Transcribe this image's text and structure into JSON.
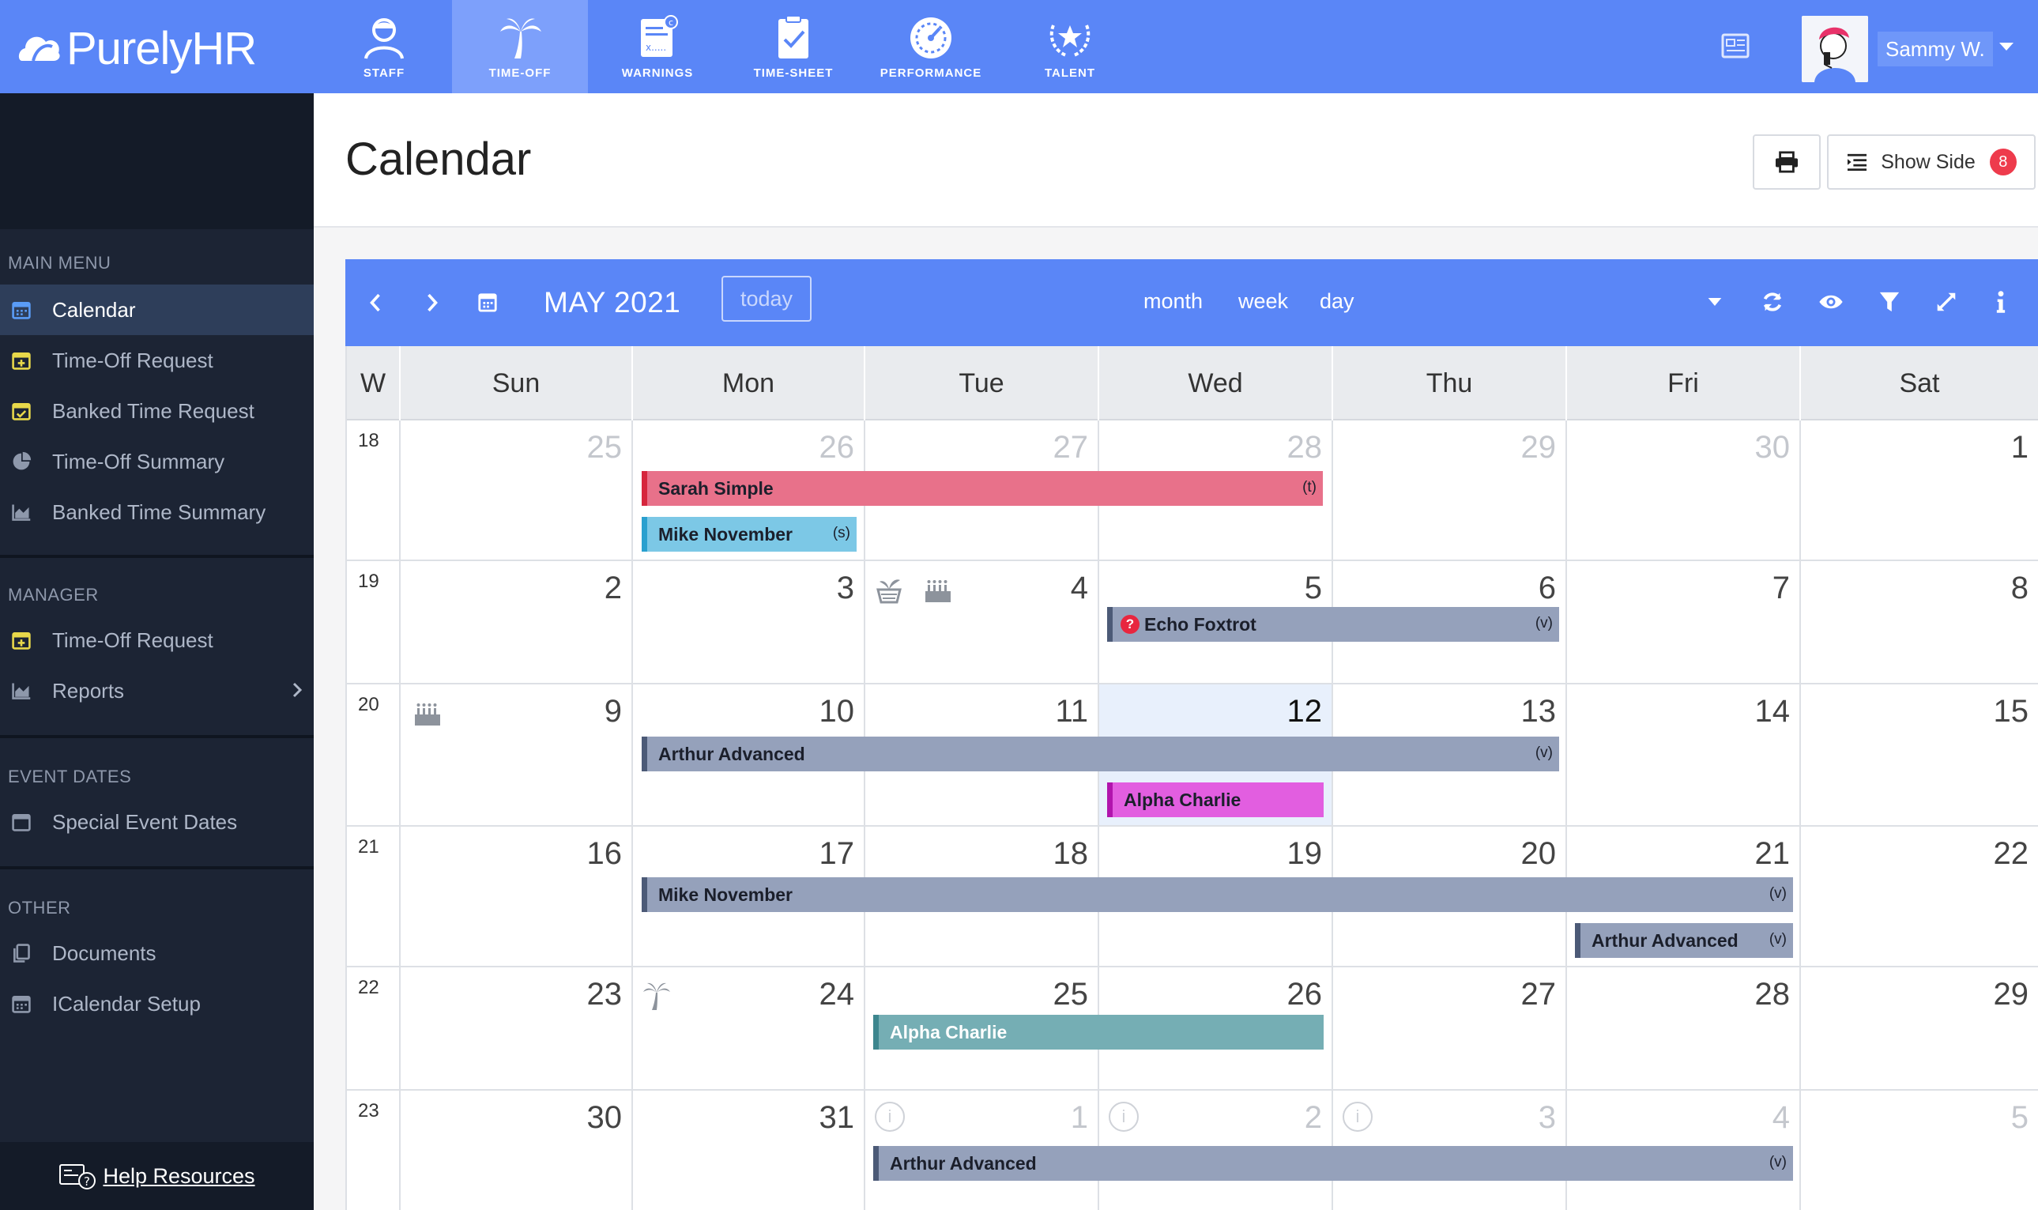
{
  "app": {
    "brand": "PurelyHR",
    "nav": [
      {
        "label": "STAFF",
        "icon": "staff-icon",
        "active": false
      },
      {
        "label": "TIME-OFF",
        "icon": "palm-tree-icon",
        "active": true
      },
      {
        "label": "WARNINGS",
        "icon": "warning-document-icon",
        "active": false
      },
      {
        "label": "TIME-SHEET",
        "icon": "clipboard-check-icon",
        "active": false
      },
      {
        "label": "PERFORMANCE",
        "icon": "gauge-icon",
        "active": false
      },
      {
        "label": "TALENT",
        "icon": "laurel-star-icon",
        "active": false
      }
    ],
    "user": {
      "name": "Sammy W."
    }
  },
  "sidebar": {
    "sections": [
      {
        "title": "MAIN MENU",
        "items": [
          {
            "label": "Calendar",
            "icon": "calendar-icon",
            "active": true
          },
          {
            "label": "Time-Off Request",
            "icon": "calendar-plus-icon"
          },
          {
            "label": "Banked Time Request",
            "icon": "calendar-check-icon"
          },
          {
            "label": "Time-Off Summary",
            "icon": "pie-chart-icon"
          },
          {
            "label": "Banked Time Summary",
            "icon": "area-chart-icon"
          }
        ]
      },
      {
        "title": "MANAGER",
        "items": [
          {
            "label": "Time-Off Request",
            "icon": "calendar-plus-icon"
          },
          {
            "label": "Reports",
            "icon": "area-chart-icon"
          }
        ]
      },
      {
        "title": "EVENT DATES",
        "items": [
          {
            "label": "Special Event Dates",
            "icon": "calendar-blank-icon"
          }
        ]
      },
      {
        "title": "OTHER",
        "items": [
          {
            "label": "Documents",
            "icon": "copy-icon"
          },
          {
            "label": "ICalendar Setup",
            "icon": "calendar-grid-icon"
          }
        ]
      }
    ],
    "help": "Help Resources"
  },
  "page": {
    "title": "Calendar",
    "show_side_label": "Show Side",
    "show_side_badge": "8"
  },
  "calendar": {
    "title": "MAY 2021",
    "today_label": "today",
    "views": [
      "month",
      "week",
      "day"
    ],
    "header": [
      "W",
      "Sun",
      "Mon",
      "Tue",
      "Wed",
      "Thu",
      "Fri",
      "Sat"
    ],
    "weeks": [
      {
        "num": "18",
        "days": [
          "25",
          "26",
          "27",
          "28",
          "29",
          "30",
          "1"
        ]
      },
      {
        "num": "19",
        "days": [
          "2",
          "3",
          "4",
          "5",
          "6",
          "7",
          "8"
        ]
      },
      {
        "num": "20",
        "days": [
          "9",
          "10",
          "11",
          "12",
          "13",
          "14",
          "15"
        ]
      },
      {
        "num": "21",
        "days": [
          "16",
          "17",
          "18",
          "19",
          "20",
          "21",
          "22"
        ]
      },
      {
        "num": "22",
        "days": [
          "23",
          "24",
          "25",
          "26",
          "27",
          "28",
          "29"
        ]
      },
      {
        "num": "23",
        "days": [
          "30",
          "31",
          "1",
          "2",
          "3",
          "4",
          "5"
        ]
      }
    ],
    "events": [
      {
        "name": "Sarah Simple",
        "tag": "(t)",
        "color": "#e8718a",
        "border": "#d6263d"
      },
      {
        "name": "Mike November",
        "tag": "(s)",
        "color": "#7cc8e6",
        "border": "#2aa0cf"
      },
      {
        "name": "Echo Foxtrot",
        "tag": "(v)",
        "color": "#95a1bb",
        "border": "#4c5a77",
        "pending": "?"
      },
      {
        "name": "Arthur Advanced",
        "tag": "(v)",
        "color": "#95a1bb",
        "border": "#4c5a77"
      },
      {
        "name": "Alpha Charlie",
        "tag": "",
        "color": "#e25ee0",
        "border": "#b114ad"
      },
      {
        "name": "Mike November",
        "tag": "(v)",
        "color": "#95a1bb",
        "border": "#4c5a77"
      },
      {
        "name": "Arthur Advanced",
        "tag": "(v)",
        "color": "#95a1bb",
        "border": "#4c5a77"
      },
      {
        "name": "Alpha Charlie",
        "tag": "",
        "color": "#75aeb4",
        "border": "#3d868e"
      },
      {
        "name": "Arthur Advanced",
        "tag": "(v)",
        "color": "#95a1bb",
        "border": "#4c5a77"
      }
    ]
  }
}
